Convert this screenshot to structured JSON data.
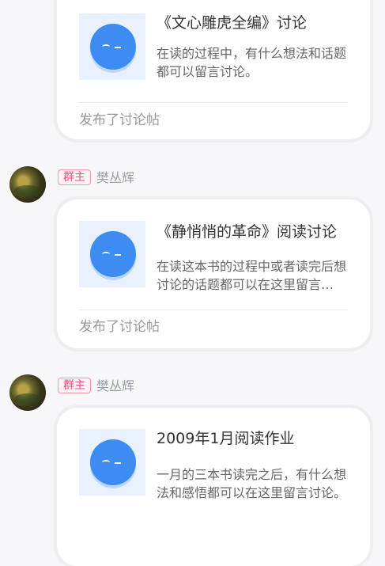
{
  "messages": [
    {
      "card": {
        "title": "《文心雕虎全编》讨论",
        "description": "在读的过程中，有什么想法和话题都可以留言讨论。",
        "footer": "发布了讨论帖"
      }
    },
    {
      "badge": "群主",
      "author": "樊丛辉",
      "card": {
        "title": "《静悄悄的革命》阅读讨论",
        "description": "在读这本书的过程中或者读完后想讨论的话题都可以在这里留言讨论。",
        "footer": "发布了讨论帖"
      }
    },
    {
      "badge": "群主",
      "author": "樊丛辉",
      "card": {
        "title": "2009年1月阅读作业",
        "description": "一月的三本书读完之后，有什么想法和感悟都可以在这里留言讨论。"
      }
    }
  ],
  "colors": {
    "badge_text": "#e8527a",
    "mascot_blue": "#3c8cf2",
    "thumb_bg": "#e9f1ff"
  },
  "icons": {
    "avatar": "landscape-avatar",
    "mascot": "blue-round-mascot-icon"
  }
}
